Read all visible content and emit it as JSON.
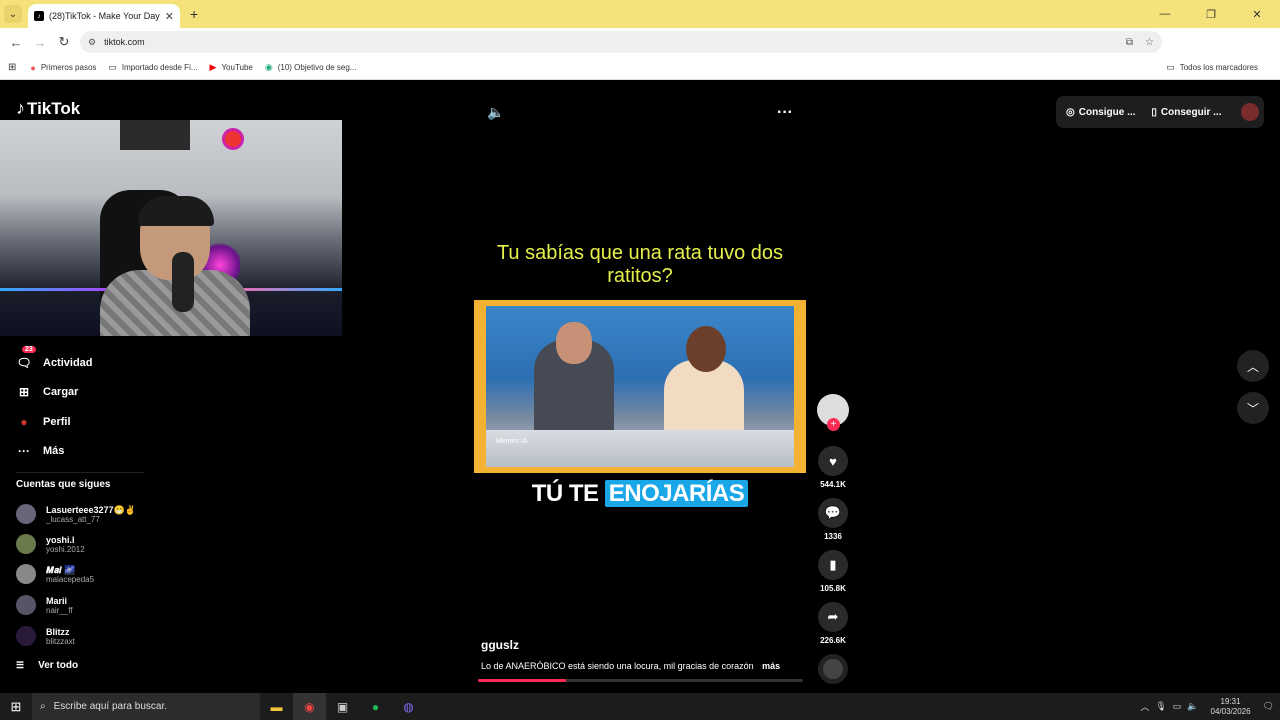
{
  "browser": {
    "tab_title": "(28)TikTok - Make Your Day",
    "url": "tiktok.com",
    "bookmarks": [
      "Primeros pasos",
      "Importado desde Fi...",
      "YouTube",
      "(10) Objetivo de seg..."
    ],
    "bookmarks_right": "Todos los marcadores"
  },
  "tiktok": {
    "logo": "TikTok",
    "nav": [
      {
        "label": "Actividad",
        "icon": "message-icon",
        "badge": "23"
      },
      {
        "label": "Cargar",
        "icon": "upload-icon"
      },
      {
        "label": "Perfil",
        "icon": "profile-icon"
      },
      {
        "label": "Más",
        "icon": "more-icon"
      }
    ],
    "following_title": "Cuentas que sigues",
    "following": [
      {
        "name": "Lasuerteee3277😁✌️",
        "handle": "_lucass_att_77"
      },
      {
        "name": "yoshi.l",
        "handle": "yoshi.2012"
      },
      {
        "name": "𝑴𝒂𝒊 🌌",
        "handle": "maiacepeda5"
      },
      {
        "name": "Marii",
        "handle": "nair__ff"
      },
      {
        "name": "Blitzz",
        "handle": "blitzzaxt"
      }
    ],
    "see_all": "Ver todo",
    "top_buttons": [
      "Consigue ...",
      "Conseguir ..."
    ],
    "video": {
      "caption": "Tu sabías que una rata tuvo dos ratitos?",
      "subtitle_plain": "TÚ TE",
      "subtitle_highlight": "ENOJARÍAS",
      "watermark": "Memes IA",
      "author": "gguslz",
      "description": "Lo de ANAERÓBICO está siendo una locura, mil gracias de corazón",
      "more": "más",
      "progress": 0.27
    },
    "actions": {
      "likes": "544.1K",
      "comments": "1336",
      "saves": "105.8K",
      "shares": "226.6K"
    }
  },
  "taskbar": {
    "search_placeholder": "Escribe aquí para buscar.",
    "time": "19:31",
    "date": "04/03/2026"
  },
  "colors": {
    "tab_bar": "#f6e27a",
    "accent": "#fe2c55",
    "caption": "#e6f04a",
    "highlight": "#1aa7e8"
  }
}
